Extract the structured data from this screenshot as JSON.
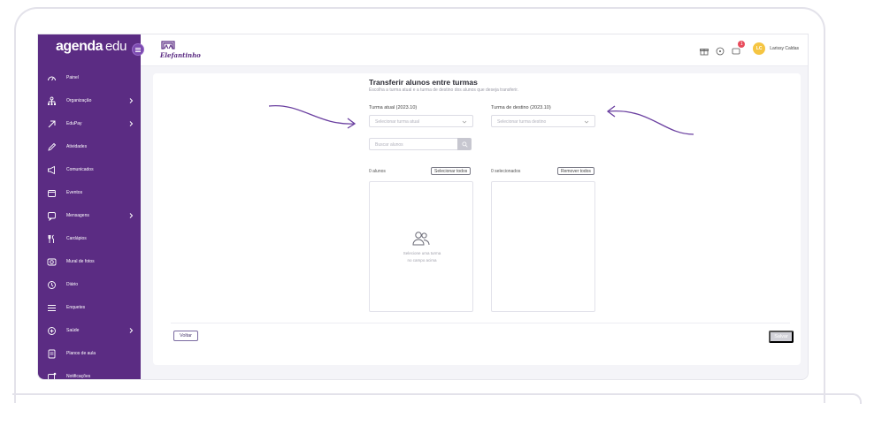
{
  "sidebar": {
    "logo_main": "agenda",
    "logo_sub": "edu",
    "items": [
      {
        "label": "Painel",
        "icon": "gauge-icon",
        "has_chevron": false
      },
      {
        "label": "Organização",
        "icon": "org-chart-icon",
        "has_chevron": true
      },
      {
        "label": "EduPay",
        "icon": "edupay-icon",
        "has_chevron": true
      },
      {
        "label": "Atividades",
        "icon": "pencil-icon",
        "has_chevron": false
      },
      {
        "label": "Comunicados",
        "icon": "megaphone-icon",
        "has_chevron": false
      },
      {
        "label": "Eventos",
        "icon": "calendar-icon",
        "has_chevron": false
      },
      {
        "label": "Mensagens",
        "icon": "chat-icon",
        "has_chevron": true
      },
      {
        "label": "Cardápios",
        "icon": "utensils-icon",
        "has_chevron": false
      },
      {
        "label": "Mural de fotos",
        "icon": "camera-icon",
        "has_chevron": false
      },
      {
        "label": "Diário",
        "icon": "clock-icon",
        "has_chevron": false
      },
      {
        "label": "Enquetes",
        "icon": "list-icon",
        "has_chevron": false
      },
      {
        "label": "Saúde",
        "icon": "health-icon",
        "has_chevron": true
      },
      {
        "label": "Planos de aula",
        "icon": "document-icon",
        "has_chevron": false
      },
      {
        "label": "Notificações",
        "icon": "notification-icon",
        "has_chevron": false
      }
    ]
  },
  "header": {
    "school_name": "Elefantinho",
    "notification_count": "1",
    "avatar_initials": "LC",
    "user_name": "Larissy Caldas"
  },
  "page": {
    "title": "Transferir alunos entre turmas",
    "subtitle": "Escolha a turma atual e a turma de destino dos alunos que deseja transferir.",
    "current_label": "Turma atual (2023.10)",
    "current_placeholder": "Selecionar turma atual",
    "dest_label": "Turma de destino (2023.10)",
    "dest_placeholder": "Selecionar turma destino",
    "search_placeholder": "Buscar alunos",
    "students_count": "0 alunos",
    "select_all": "Selecionar todos",
    "selected_count": "0 selecionados",
    "remove_all": "Remover todos",
    "empty_line1": "Selecione uma turma",
    "empty_line2": "no campo acima",
    "back": "Voltar",
    "save": "Salvar"
  },
  "colors": {
    "sidebar_bg": "#5b2c83",
    "annotation_arrow": "#6a3fa0",
    "avatar": "#f5c542",
    "badge": "#e84c5c"
  }
}
